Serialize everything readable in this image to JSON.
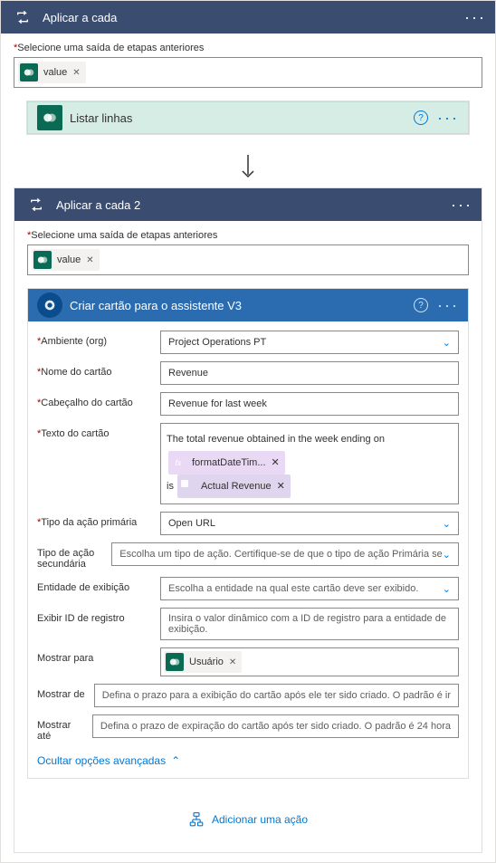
{
  "outerLoop": {
    "title": "Aplicar a cada",
    "selectLabel": "Selecione uma saída de etapas anteriores",
    "valuePill": "value"
  },
  "listRows": {
    "title": "Listar linhas"
  },
  "innerLoop": {
    "title": "Aplicar a cada 2",
    "selectLabel": "Selecione uma saída de etapas anteriores",
    "valuePill": "value"
  },
  "createCard": {
    "title": "Criar cartão para o assistente V3",
    "fields": {
      "envLabel": "Ambiente (org)",
      "envValue": "Project Operations PT",
      "cardNameLabel": "Nome do cartão",
      "cardNameValue": "Revenue",
      "cardHeaderLabel": "Cabeçalho do cartão",
      "cardHeaderValue": "Revenue for last week",
      "cardTextLabel": "Texto do cartão",
      "cardTextPart1": "The total revenue obtained in the week ending on",
      "cardTextFxToken": "formatDateTim...",
      "cardTextPart2": "is",
      "cardTextDynToken": "Actual Revenue",
      "primaryActionTypeLabel": "Tipo da ação primária",
      "primaryActionTypeValue": "Open URL",
      "secondaryActionTypeLabel": "Tipo de ação secundária",
      "secondaryActionTypePlaceholder": "Escolha um tipo de ação. Certifique-se de que o tipo de ação Primária se",
      "displayEntityLabel": "Entidade de exibição",
      "displayEntityPlaceholder": "Escolha a entidade na qual este cartão deve ser exibido.",
      "recordIdLabel": "Exibir ID de registro",
      "recordIdPlaceholder": "Insira o valor dinâmico com a ID de registro para a entidade de exibição.",
      "showToLabel": "Mostrar para",
      "showToToken": "Usuário",
      "showFromLabel": "Mostrar de",
      "showFromPlaceholder": "Defina o prazo para a exibição do cartão após ele ter sido criado. O padrão é ir",
      "showUntilLabel": "Mostrar até",
      "showUntilPlaceholder": "Defina o prazo de expiração do cartão após ter sido criado. O padrão é 24 hora"
    },
    "hideAdvanced": "Ocultar opções avançadas"
  },
  "addAction": "Adicionar uma ação"
}
